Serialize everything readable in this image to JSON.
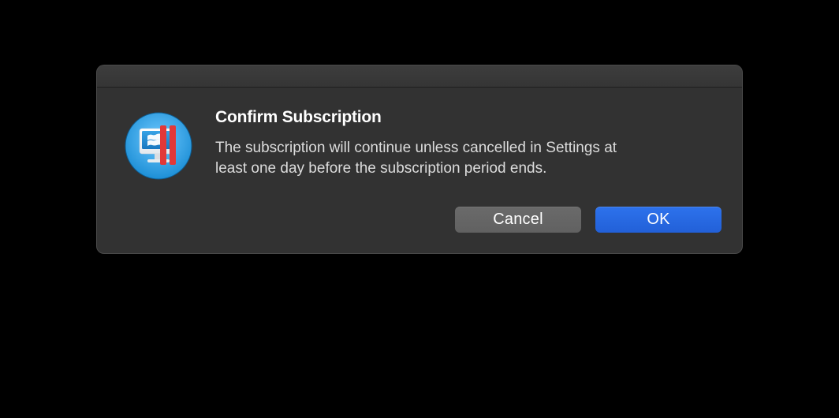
{
  "dialog": {
    "title": "Confirm Subscription",
    "message": "The subscription will continue unless cancelled in Settings at least one day before the subscription period ends.",
    "cancel_label": "Cancel",
    "ok_label": "OK"
  }
}
